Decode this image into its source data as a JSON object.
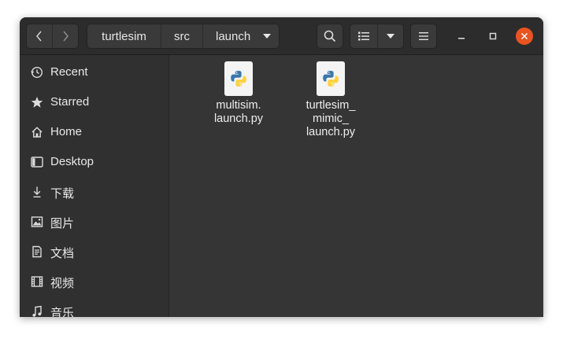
{
  "toolbar": {
    "breadcrumbs": [
      "turtlesim",
      "src",
      "launch"
    ],
    "back_icon": "chevron-left-icon",
    "forward_icon": "chevron-right-icon",
    "search_icon": "search-icon",
    "view_icon": "list-view-icon",
    "view_menu_icon": "caret-down-icon",
    "menu_icon": "hamburger-menu-icon"
  },
  "window_controls": {
    "minimize_icon": "minimize-icon",
    "maximize_icon": "maximize-icon",
    "close_icon": "close-icon",
    "close_color": "#e95420"
  },
  "sidebar": {
    "items": [
      {
        "label": "Recent",
        "icon": "clock-icon"
      },
      {
        "label": "Starred",
        "icon": "star-icon"
      },
      {
        "label": "Home",
        "icon": "home-icon"
      },
      {
        "label": "Desktop",
        "icon": "desktop-icon"
      },
      {
        "label": "下载",
        "icon": "download-icon"
      },
      {
        "label": "图片",
        "icon": "pictures-icon"
      },
      {
        "label": "文档",
        "icon": "documents-icon"
      },
      {
        "label": "视频",
        "icon": "video-icon"
      },
      {
        "label": "音乐",
        "icon": "music-icon"
      }
    ]
  },
  "files": [
    {
      "name": "multisim.\nlaunch.py",
      "icon": "python-file-icon"
    },
    {
      "name": "turtlesim_\nmimic_\nlaunch.py",
      "icon": "python-file-icon"
    }
  ],
  "colors": {
    "accent": "#e95420",
    "headerbar": "#2c2c2c",
    "sidebar": "#303030",
    "content": "#353535"
  }
}
